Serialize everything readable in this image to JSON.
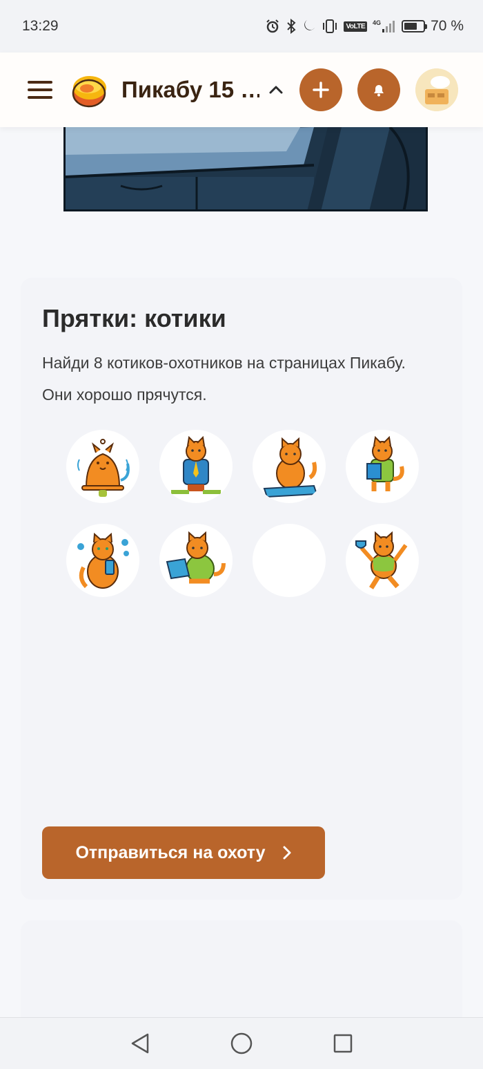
{
  "status_bar": {
    "time": "13:29",
    "network_label": "VoLTE",
    "signal_label": "4G",
    "battery_percent": "70 %",
    "battery_level": 0.7
  },
  "header": {
    "title": "Пикабу 15 …",
    "icons": [
      "menu-icon",
      "pikabu-logo",
      "chevron-up-icon",
      "plus-icon",
      "bell-icon",
      "avatar"
    ]
  },
  "card": {
    "title": "Прятки: котики",
    "description": "Найди 8 котиков-охотников на страницах Пикабу. Они хорошо прячутся.",
    "cats": [
      {
        "name": "cat-bell",
        "found": true
      },
      {
        "name": "cat-businessman",
        "found": true
      },
      {
        "name": "cat-keyboard",
        "found": true
      },
      {
        "name": "cat-accordion",
        "found": true
      },
      {
        "name": "cat-phone",
        "found": true
      },
      {
        "name": "cat-laptop",
        "found": true
      },
      {
        "name": "cat-hidden",
        "found": false
      },
      {
        "name": "cat-trophy",
        "found": true
      }
    ],
    "button_label": "Отправиться на охоту"
  },
  "colors": {
    "accent": "#b9652b",
    "header_text": "#3a2412",
    "background": "#f6f7fa"
  }
}
